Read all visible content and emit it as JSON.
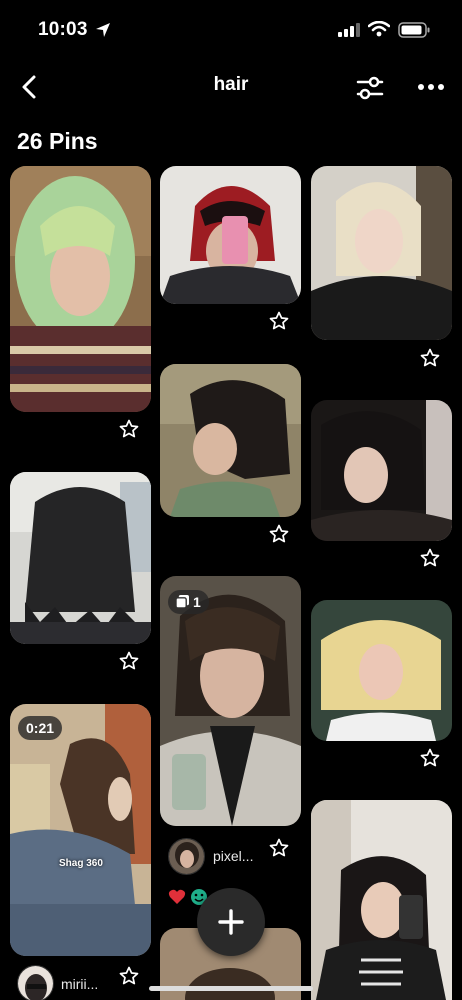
{
  "status_bar": {
    "time": "10:03"
  },
  "header": {
    "title": "hair"
  },
  "board": {
    "pin_count": "26 Pins"
  },
  "pins": {
    "video_duration": "0:21",
    "video_overlay_text": "Shag 360",
    "multi_count": "1",
    "creator_1": "pixel...",
    "creator_2": "mirii..."
  },
  "colors": {
    "background": "#000000",
    "fab": "#2a2a2a",
    "text": "#ffffff"
  }
}
